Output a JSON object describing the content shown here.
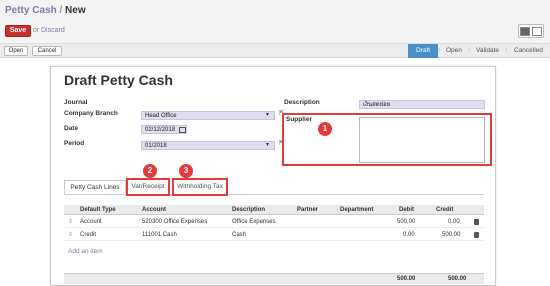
{
  "header": {
    "breadcrumb_parent": "Petty Cash",
    "breadcrumb_sep": "/",
    "breadcrumb_current": "New",
    "save_label": "Save",
    "or_text": "or",
    "discard_label": "Discard"
  },
  "actions": {
    "open_label": "Open",
    "cancel_label": "Cancel"
  },
  "status_bar": [
    "Draft",
    "Open",
    "Validate",
    "Cancelled"
  ],
  "form": {
    "title": "Draft Petty Cash",
    "journal_label": "Journal",
    "company_branch_label": "Company Branch",
    "company_branch_value": "Head Office",
    "date_label": "Date",
    "date_value": "02/12/2018",
    "period_label": "Period",
    "period_value": "01/2018",
    "description_label": "Description",
    "description_value": "เงินสดย่อย",
    "supplier_label": "Supplier"
  },
  "tabs": [
    "Petty Cash Lines",
    "Vat/Receipt",
    "Withholding Tax"
  ],
  "callouts": [
    "1",
    "2",
    "3"
  ],
  "table": {
    "headers": [
      "Default Type",
      "Account",
      "Description",
      "Partner",
      "Department",
      "Debit",
      "Credit"
    ],
    "rows": [
      {
        "type": "Account",
        "account": "520300 Office Expenses",
        "description": "Office Expenses",
        "partner": "",
        "department": "",
        "debit": "500.00",
        "credit": "0.00"
      },
      {
        "type": "Credit",
        "account": "111001 Cash",
        "description": "Cash",
        "partner": "",
        "department": "",
        "debit": "0.00",
        "credit": "500.00"
      }
    ],
    "add_item_label": "Add an item",
    "total_debit": "500.00",
    "total_credit": "500.00"
  },
  "colors": {
    "save_button": "#c9302c",
    "status_active": "#4a90c8",
    "callout": "#e53a3a",
    "link": "#7c7bad"
  }
}
